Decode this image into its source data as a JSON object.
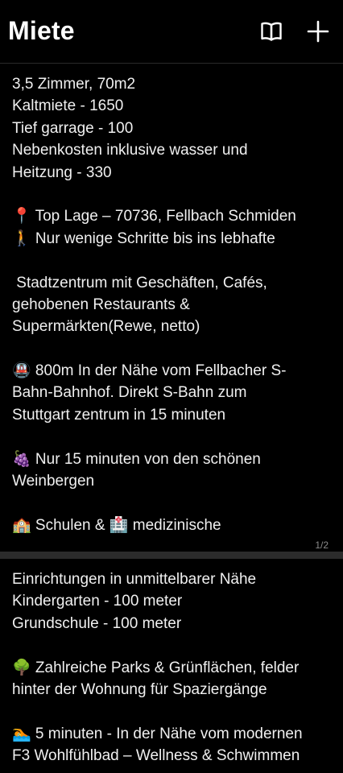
{
  "header": {
    "title": "Miete"
  },
  "icons": {
    "book": "book-open-icon",
    "plus": "plus-icon"
  },
  "page1": {
    "lines": [
      "3,5 Zimmer, 70m2",
      "Kaltmiete - 1650",
      "Tief garrage - 100",
      "Nebenkosten inklusive wasser und",
      "Heitzung - 330",
      "",
      "📍 Top Lage – 70736, Fellbach Schmiden",
      "🚶 Nur wenige Schritte bis ins lebhafte",
      "",
      " Stadtzentrum mit Geschäften, Cafés,",
      "gehobenen Restaurants &",
      "Supermärkten(Rewe, netto)",
      "",
      "🚇 800m In der Nähe vom Fellbacher S-",
      "Bahn-Bahnhof. Direkt S-Bahn zum",
      "Stuttgart zentrum in 15 minuten",
      "",
      "🍇 Nur 15 minuten von den schönen",
      "Weinbergen",
      "",
      "🏫 Schulen & 🏥 medizinische"
    ],
    "pager": "1/2"
  },
  "page2": {
    "lines": [
      "Einrichtungen in unmittelbarer Nähe",
      "Kindergarten - 100 meter",
      "Grundschule - 100 meter",
      "",
      "🌳 Zahlreiche Parks & Grünflächen, felder",
      "hinter der Wohnung für Spaziergänge",
      "",
      "🏊 5 minuten - In der Nähe vom modernen",
      "F3 Wohlfühlbad – Wellness & Schwimmen"
    ]
  }
}
